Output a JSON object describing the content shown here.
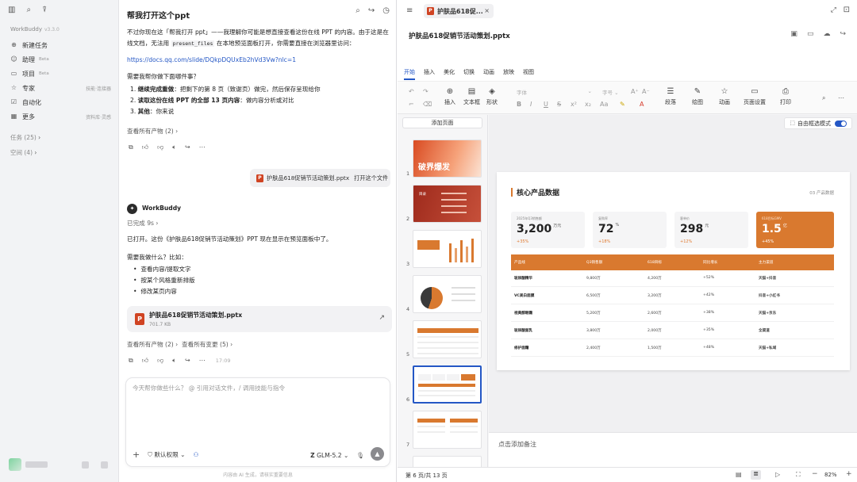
{
  "sidebar": {
    "brand": "WorkBuddy",
    "version": "v3.3.0",
    "items": [
      {
        "icon": "plus-circle-icon",
        "label": "新建任务",
        "badge": "",
        "hint": ""
      },
      {
        "icon": "bot-icon",
        "label": "助理",
        "badge": "Beta",
        "hint": ""
      },
      {
        "icon": "folder-icon",
        "label": "项目",
        "badge": "Beta",
        "hint": ""
      },
      {
        "icon": "user-star-icon",
        "label": "专家",
        "badge": "",
        "hint": "技能·连接器"
      },
      {
        "icon": "check-square-icon",
        "label": "自动化",
        "badge": "",
        "hint": ""
      },
      {
        "icon": "grid-icon",
        "label": "更多",
        "badge": "",
        "hint": "资料库·灵感"
      }
    ],
    "sections": [
      {
        "label": "任务 (25)"
      },
      {
        "label": "空间 (4)"
      }
    ]
  },
  "chat": {
    "title": "帮我打开这个ppt",
    "msg1": "不过你现在这「帮我打开 ppt」——我理解你可能是想直接查看这份在线 PPT 的内容。由于这是在线文档，无法用",
    "msg1_code": "present_files",
    "msg1_tail": "在本地预览面板打开，你需要直接在浏览器里访问：",
    "link": "https://docs.qq.com/slide/DQkpDQUxEb2hVd3Vw?nlc=1",
    "question": "需要我帮你做下面哪件事？",
    "options": [
      {
        "num": "1.",
        "bold": "继续完成重做",
        "text": "：把剩下的第 8 页（致谢页）做完，然后保存呈现给你"
      },
      {
        "num": "2.",
        "bold": "读取这份在线 PPT 的全部 13 页内容",
        "text": "：做内容分析或对比"
      },
      {
        "num": "3.",
        "bold": "其他",
        "text": "：你来说"
      }
    ],
    "view_all_1": "查看所有产物 (2)",
    "user_file": "护肤品618促销节活动策划.pptx",
    "user_msg": "打开这个文件",
    "agent_name": "WorkBuddy",
    "done": "已完成 9s",
    "reply": "已打开。这份《护肤品618促销节活动策划》PPT 现在显示在预览面板中了。",
    "ask": "需要我做什么？比如：",
    "bullets": [
      "查看内容/提取文字",
      "按某个风格重新排版",
      "修改某页内容"
    ],
    "file_name": "护肤品618促销节活动策划.pptx",
    "file_size": "701.7 KB",
    "view_all_2": "查看所有产物 (2)",
    "view_changes": "查看所有变更 (5)",
    "time": "17:09",
    "input_placeholder": "今天帮你做些什么？ @ 引用对话文件，/ 调用技能与指令",
    "perm": "默认权限",
    "model": "GLM-5.2",
    "footer": "内容由 AI 生成，请核实重要信息"
  },
  "ppt": {
    "tab_title": "护肤品618促...",
    "doc_title": "护肤品618促销节活动策划.pptx",
    "menus": [
      "开始",
      "插入",
      "美化",
      "切换",
      "动画",
      "放映",
      "视图"
    ],
    "tools": [
      "插入",
      "文本框",
      "形状",
      "段落",
      "绘图",
      "动画",
      "页面设置",
      "打印"
    ],
    "font_placeholder": "字体",
    "size_placeholder": "字号",
    "add_page": "添加页面",
    "free_select": "自由框选模式",
    "notes_placeholder": "点击添加备注",
    "page_status": "第 6 页/共 13 页",
    "zoom": "82%",
    "thumbs": [
      {
        "n": "1",
        "title": "破界爆发"
      },
      {
        "n": "2",
        "title": "目录"
      },
      {
        "n": "3",
        "title": ""
      },
      {
        "n": "4",
        "title": ""
      },
      {
        "n": "5",
        "title": ""
      },
      {
        "n": "6",
        "title": ""
      },
      {
        "n": "7",
        "title": ""
      }
    ],
    "slide": {
      "title": "核心产品数据",
      "tag": "03 产品数据",
      "kpis": [
        {
          "label": "2025年Q3销售额",
          "value": "3,200",
          "unit": "万元",
          "change": "+35%"
        },
        {
          "label": "复购率",
          "value": "72",
          "unit": "%",
          "change": "+18%"
        },
        {
          "label": "客单价",
          "value": "298",
          "unit": "元",
          "change": "+12%"
        },
        {
          "label": "618目标GMV",
          "value": "1.5",
          "unit": "亿",
          "change": "+45%"
        }
      ],
      "headers": [
        "产品线",
        "Q3销售额",
        "618目标",
        "同比增长",
        "主力渠道"
      ],
      "rows": [
        [
          "玻尿酸精华",
          "9,800万",
          "4,200万",
          "+52%",
          "天猫+抖音"
        ],
        [
          "VC美白面膜",
          "6,500万",
          "3,200万",
          "+42%",
          "抖音+小红书"
        ],
        [
          "视黄醇眼霜",
          "5,200万",
          "2,600万",
          "+38%",
          "天猫+京东"
        ],
        [
          "玻尿酸面乳",
          "3,800万",
          "2,000万",
          "+35%",
          "全渠道"
        ],
        [
          "修护面霜",
          "2,400万",
          "1,500万",
          "+48%",
          "天猫+私域"
        ]
      ]
    }
  },
  "colors": {
    "accent": "#d9792f",
    "link": "#2457c5",
    "brand_red": "#d04423"
  }
}
